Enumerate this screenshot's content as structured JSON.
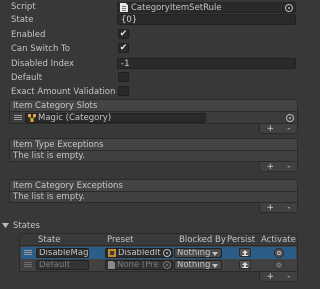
{
  "props": {
    "script_label": "Script",
    "script_value": "CategoryItemSetRule",
    "state_label": "State",
    "state_value": "{0}",
    "enabled_label": "Enabled",
    "enabled_checked": true,
    "can_switch_label": "Can Switch To",
    "can_switch_checked": true,
    "disabled_index_label": "Disabled Index",
    "disabled_index_value": "-1",
    "default_label": "Default",
    "default_checked": false,
    "exact_amount_label": "Exact Amount Validation",
    "exact_amount_checked": false
  },
  "item_category_slots": {
    "header": "Item Category Slots",
    "items": [
      {
        "label": "Magic (Category)"
      }
    ],
    "add": "+",
    "remove": "-"
  },
  "item_type_exceptions": {
    "header": "Item Type Exceptions",
    "empty": "The list is empty.",
    "add": "+",
    "remove": "-"
  },
  "item_category_exceptions": {
    "header": "Item Category Exceptions",
    "empty": "The list is empty.",
    "add": "+",
    "remove": "-"
  },
  "states": {
    "title": "States",
    "columns": {
      "state": "State",
      "preset": "Preset",
      "blocked_by": "Blocked By",
      "persist": "Persist",
      "activate": "Activate"
    },
    "rows": [
      {
        "state": "DisableMagi",
        "preset": "DisabledIt",
        "blocked_by": "Nothing",
        "enabled": true
      },
      {
        "state": "Default",
        "preset": "None (Pre",
        "blocked_by": "Nothing",
        "enabled": false
      }
    ],
    "add": "+",
    "remove": "-"
  },
  "colors": {
    "background": "#383838",
    "field": "#2a2a2a",
    "header": "#444444",
    "selected_row": "#2c5d87"
  }
}
